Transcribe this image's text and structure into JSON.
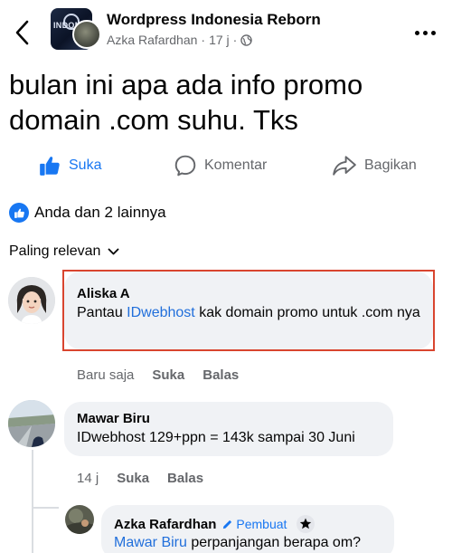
{
  "header": {
    "title": "Wordpress Indonesia Reborn",
    "author": "Azka Rafardhan",
    "time": "17 j",
    "separator": "·",
    "group_avatar_text": "INDONE"
  },
  "post": {
    "text": "bulan ini apa ada info promo domain .com suhu. Tks"
  },
  "actions": {
    "like": "Suka",
    "comment": "Komentar",
    "share": "Bagikan"
  },
  "reactions": {
    "text": "Anda dan 2 lainnya"
  },
  "sort": {
    "label": "Paling relevan"
  },
  "comments": [
    {
      "name": "Aliska A",
      "text_before": "Pantau ",
      "link": "IDwebhost",
      "text_after": " kak domain promo untuk .com nya",
      "time": "Baru saja",
      "like": "Suka",
      "reply": "Balas"
    },
    {
      "name": "Mawar Biru",
      "text": "IDwebhost 129+ppn = 143k sampai 30 Juni",
      "time": "14 j",
      "like": "Suka",
      "reply": "Balas"
    }
  ],
  "reply": {
    "name": "Azka Rafardhan",
    "badge": "Pembuat",
    "mention": "Mawar Biru",
    "text": " perpanjangan berapa om?"
  },
  "colors": {
    "accent": "#1877f2",
    "link": "#216fdb",
    "highlight": "#d9452f",
    "bubble": "#f0f2f5",
    "secondary_text": "#65676b"
  }
}
